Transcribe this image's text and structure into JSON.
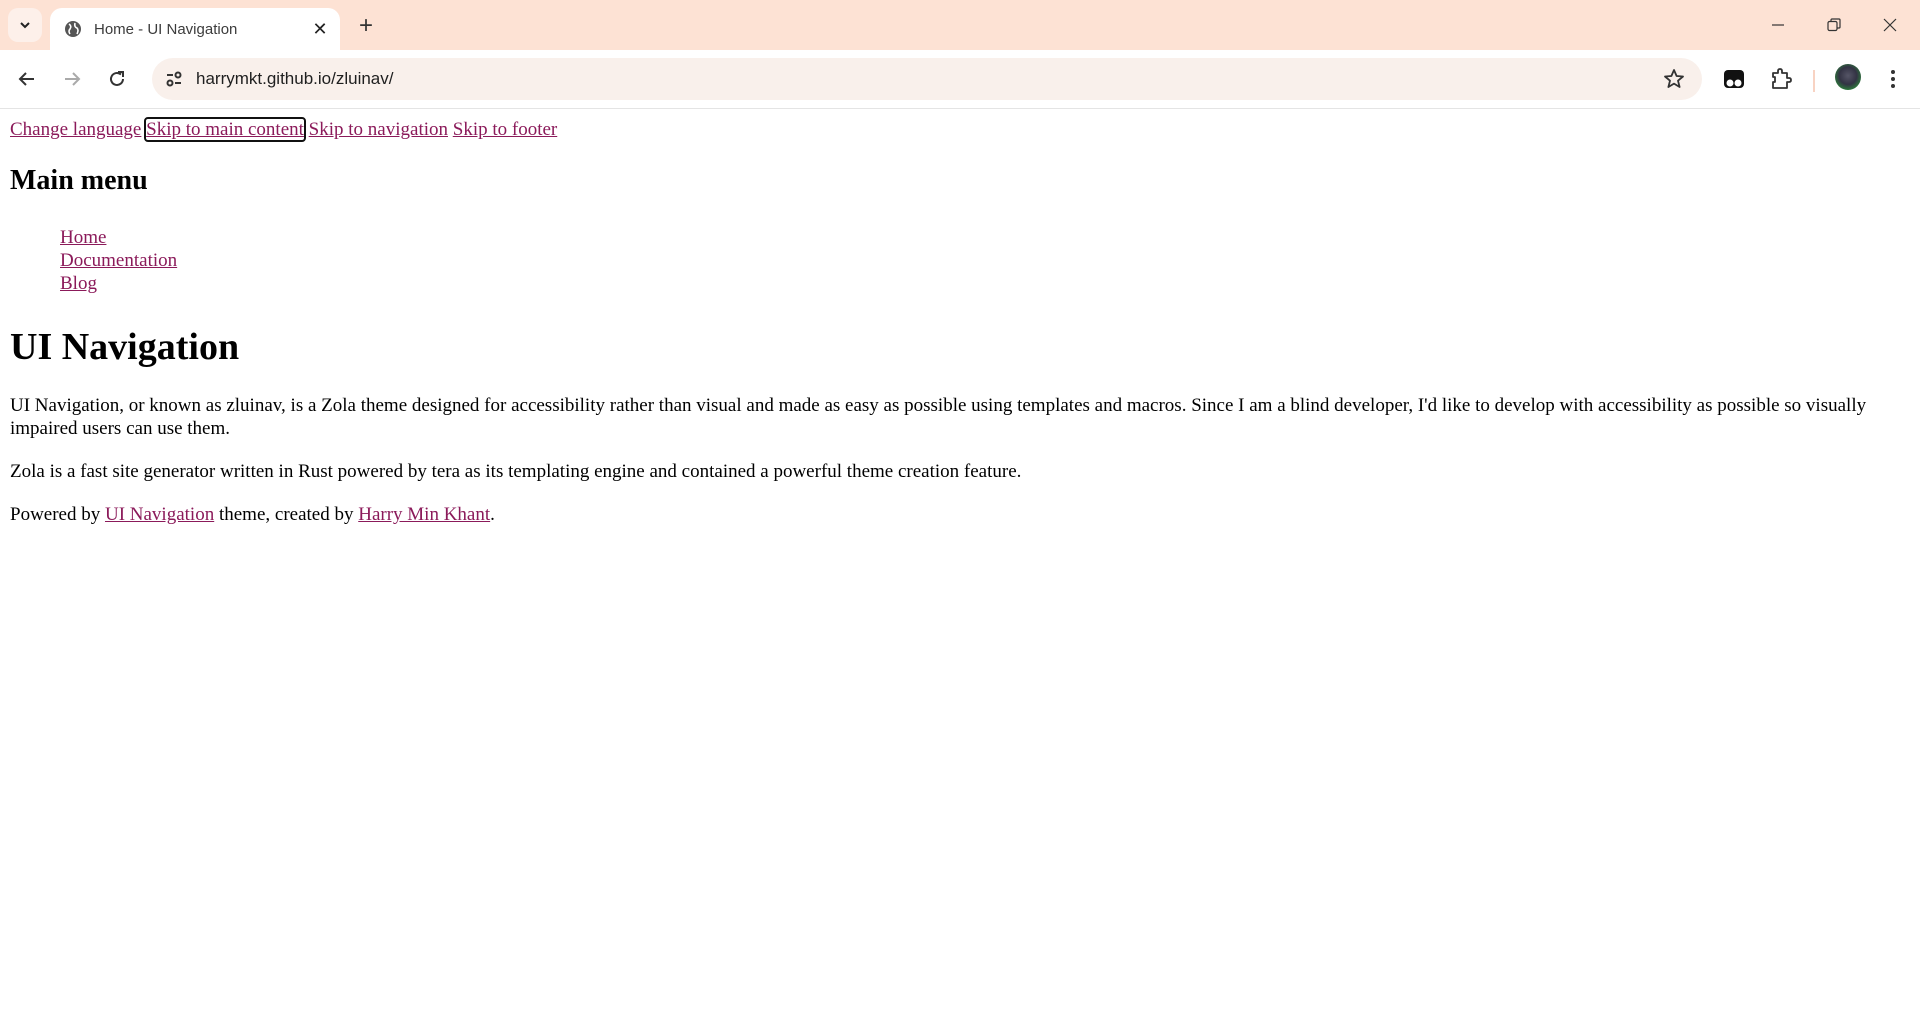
{
  "browser": {
    "tab": {
      "title": "Home - UI Navigation",
      "favicon": "globe-icon"
    },
    "url": "harrymkt.github.io/zluinav/",
    "icons": [
      "tab-search-icon",
      "close-icon",
      "new-tab-icon",
      "minimize-icon",
      "restore-icon",
      "window-close-icon",
      "back-icon",
      "forward-icon",
      "reload-icon",
      "site-info-icon",
      "bookmark-star-icon",
      "extension-tampermonkey-icon",
      "extensions-puzzle-icon",
      "profile-avatar",
      "menu-kebab-icon"
    ],
    "colors": {
      "titlebar": "#fde2d4",
      "omnibox": "#f9f0eb",
      "link": "#8b1a5a"
    }
  },
  "page": {
    "skip_links": [
      "Change language",
      "Skip to main content",
      "Skip to navigation",
      "Skip to footer"
    ],
    "menu_heading": "Main menu",
    "menu_items": [
      "Home",
      "Documentation",
      "Blog"
    ],
    "title": "UI Navigation",
    "paragraphs": [
      "UI Navigation, or known as zluinav, is a Zola theme designed for accessibility rather than visual and made as easy as possible using templates and macros. Since I am a blind developer, I'd like to develop with accessibility as possible so visually impaired users can use them.",
      "Zola is a fast site generator written in Rust powered by tera as its templating engine and contained a powerful theme creation feature."
    ],
    "footer": {
      "prefix": "Powered by ",
      "theme_link": "UI Navigation",
      "middle": " theme, created by ",
      "author_link": "Harry Min Khant",
      "suffix": "."
    }
  }
}
